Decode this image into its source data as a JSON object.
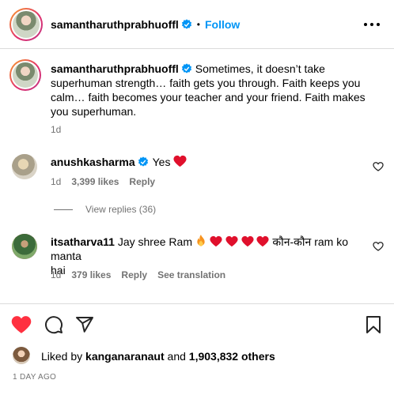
{
  "header": {
    "username": "samantharuthprabhuoffl",
    "follow_label": "Follow",
    "separator": "•"
  },
  "caption": {
    "username": "samantharuthprabhuoffl",
    "text": "Sometimes, it doesn’t take superhuman strength… faith gets you through. Faith keeps you calm… faith becomes your teacher and your friend. Faith makes you superhuman.",
    "line1": "Sometimes, it doesn’t take",
    "line2": "superhuman strength… faith gets you through. Faith keeps you",
    "line3": "calm… faith becomes your teacher and your friend. Faith makes",
    "line4": "you superhuman.",
    "age": "1d"
  },
  "comments": [
    {
      "username": "anushkasharma",
      "text": "Yes",
      "age": "1d",
      "likes": "3,399 likes",
      "reply_label": "Reply",
      "view_replies": "View replies (36)"
    },
    {
      "username": "itsatharva11",
      "text_line1": "Jay shree Ram",
      "text_line1b": "कौन-कौन ram ko manta",
      "text_line2": "hai",
      "age": "1d",
      "likes": "379 likes",
      "reply_label": "Reply",
      "translate_label": "See translation"
    }
  ],
  "footer": {
    "liked_by_prefix": "Liked by",
    "liked_by_user": "kanganaranaut",
    "liked_by_and": "and",
    "liked_by_count": "1,903,832 others",
    "date": "1 DAY AGO"
  },
  "colors": {
    "accent": "#0095f6",
    "like_red": "#ff3040",
    "muted": "#737373",
    "verified": "#0095f6"
  },
  "icons": [
    "verified-badge-icon",
    "more-options-icon",
    "heart-icon",
    "comment-icon",
    "share-icon",
    "bookmark-icon",
    "red-heart-emoji",
    "fire-emoji"
  ]
}
